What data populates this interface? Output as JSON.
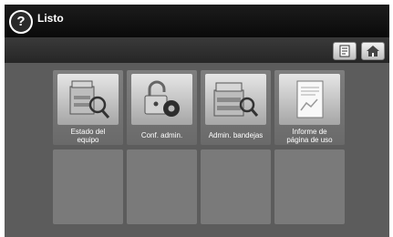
{
  "header": {
    "title": "Listo",
    "help_icon": "question-mark-icon"
  },
  "toolbar": {
    "buttons": [
      {
        "icon": "report-icon"
      },
      {
        "icon": "home-icon"
      }
    ]
  },
  "tiles": [
    {
      "label": "Estado del\nequipo",
      "icon": "machine-status-icon"
    },
    {
      "label": "Conf. admin.",
      "icon": "admin-lock-gear-icon"
    },
    {
      "label": "Admin. bandejas",
      "icon": "tray-admin-icon"
    },
    {
      "label": "Informe de\npágina de uso",
      "icon": "usage-report-icon"
    }
  ],
  "colors": {
    "background": "#5c5c5c",
    "header": "#111111",
    "tile": "#767676",
    "text": "#ffffff"
  }
}
